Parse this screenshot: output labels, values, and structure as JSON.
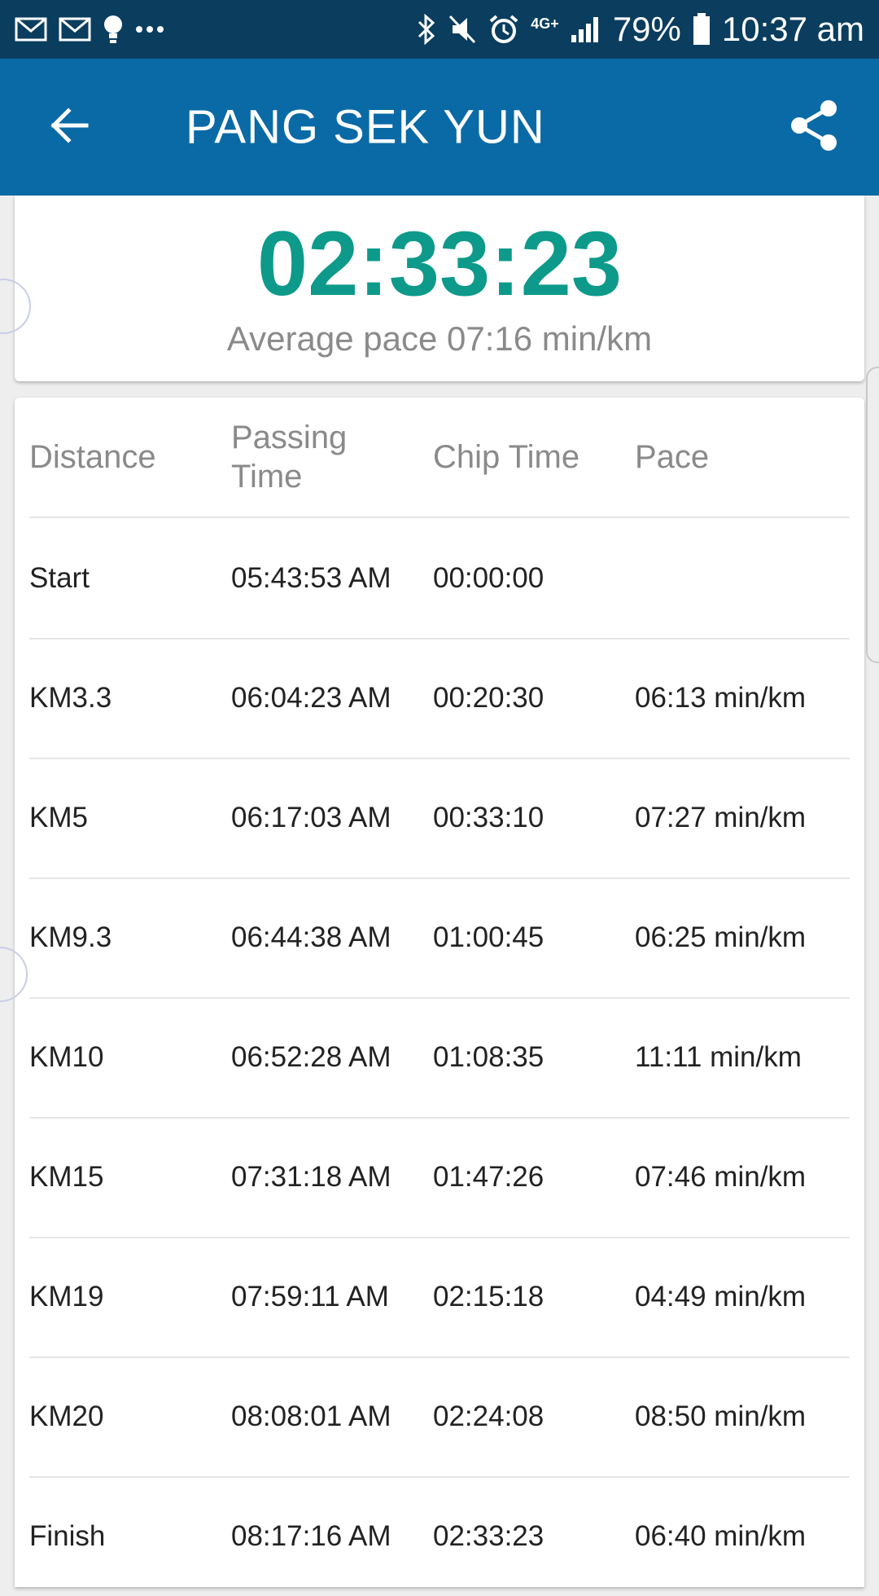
{
  "status_bar": {
    "battery": "79%",
    "time": "10:37 am",
    "network": "4G+"
  },
  "app_bar": {
    "title": "PANG SEK YUN"
  },
  "summary": {
    "total_time": "02:33:23",
    "average_pace": "Average pace 07:16 min/km"
  },
  "splits": {
    "headers": {
      "distance": "Distance",
      "passing_time": "Passing Time",
      "chip_time": "Chip Time",
      "pace": "Pace"
    },
    "rows": [
      {
        "distance": "Start",
        "passing_time": "05:43:53 AM",
        "chip_time": "00:00:00",
        "pace": ""
      },
      {
        "distance": "KM3.3",
        "passing_time": "06:04:23 AM",
        "chip_time": "00:20:30",
        "pace": "06:13 min/km"
      },
      {
        "distance": "KM5",
        "passing_time": "06:17:03 AM",
        "chip_time": "00:33:10",
        "pace": "07:27 min/km"
      },
      {
        "distance": "KM9.3",
        "passing_time": "06:44:38 AM",
        "chip_time": "01:00:45",
        "pace": "06:25 min/km"
      },
      {
        "distance": "KM10",
        "passing_time": "06:52:28 AM",
        "chip_time": "01:08:35",
        "pace": "11:11 min/km"
      },
      {
        "distance": "KM15",
        "passing_time": "07:31:18 AM",
        "chip_time": "01:47:26",
        "pace": "07:46 min/km"
      },
      {
        "distance": "KM19",
        "passing_time": "07:59:11 AM",
        "chip_time": "02:15:18",
        "pace": "04:49 min/km"
      },
      {
        "distance": "KM20",
        "passing_time": "08:08:01 AM",
        "chip_time": "02:24:08",
        "pace": "08:50 min/km"
      },
      {
        "distance": "Finish",
        "passing_time": "08:17:16 AM",
        "chip_time": "02:33:23",
        "pace": "06:40 min/km"
      }
    ]
  },
  "colors": {
    "status_bar": "#0a3d5e",
    "app_bar": "#0a6aa6",
    "accent_time": "#0d9a8a"
  },
  "icons": {
    "status_left": [
      "mail-icon",
      "mail-icon",
      "lightbulb-icon",
      "more-notifications-icon"
    ],
    "status_right": [
      "bluetooth-icon",
      "mute-icon",
      "alarm-icon",
      "network-icon",
      "signal-icon",
      "battery-icon"
    ],
    "app_bar": [
      "back-arrow-icon",
      "share-icon"
    ]
  }
}
